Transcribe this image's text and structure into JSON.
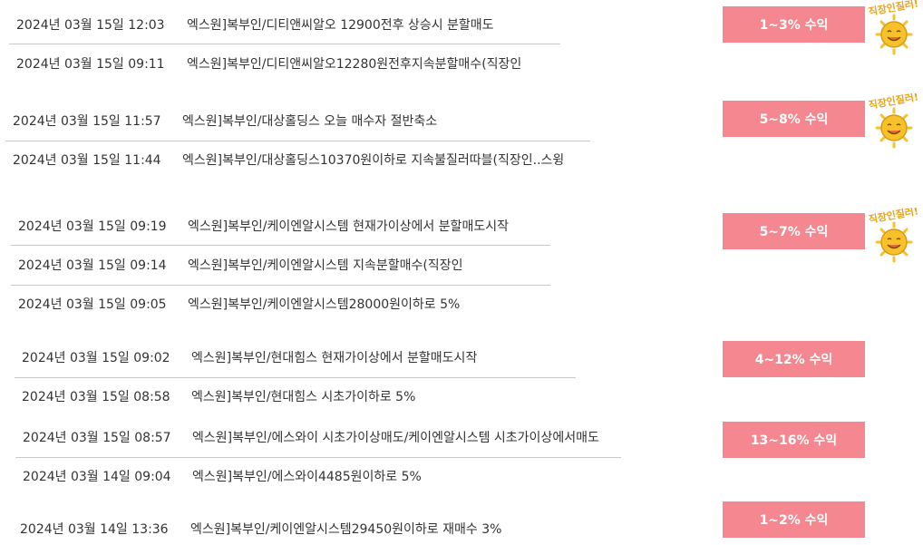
{
  "rows": [
    {
      "date": "2024년 03월 15일 12:03",
      "msg": "엑스원]복부인/디티앤씨알오 12900전후 상승시 분할매도"
    },
    {
      "date": "2024년 03월 15일 09:11",
      "msg": "엑스원]복부인/디티앤씨알오12280원전후지속분할매수(직장인"
    },
    {
      "date": "2024년 03월 15일 11:57",
      "msg": "엑스원]복부인/대상홀딩스 오늘 매수자 절반축소"
    },
    {
      "date": "2024년 03월 15일 11:44",
      "msg": "엑스원]복부인/대상홀딩스10370원이하로 지속불질러따블(직장인..스윙"
    },
    {
      "date": "2024년 03월 15일 09:19",
      "msg": "엑스원]복부인/케이엔알시스템 현재가이상에서 분할매도시작"
    },
    {
      "date": "2024년 03월 15일 09:14",
      "msg": "엑스원]복부인/케이엔알시스템 지속분할매수(직장인"
    },
    {
      "date": "2024년 03월 15일 09:05",
      "msg": "엑스원]복부인/케이엔알시스템28000원이하로 5%"
    },
    {
      "date": "2024년 03월 15일 09:02",
      "msg": "엑스원]복부인/현대힘스 현재가이상에서 분할매도시작"
    },
    {
      "date": "2024년 03월 15일 08:58",
      "msg": "엑스원]복부인/현대힘스 시초가이하로 5%"
    },
    {
      "date": "2024년 03월 15일 08:57",
      "msg": "엑스원]복부인/에스와이 시초가이상매도/케이엔알시스템 시초가이상에서매도"
    },
    {
      "date": "2024년 03월 14일 09:04",
      "msg": "엑스원]복부인/에스와이4485원이하로 5%"
    },
    {
      "date": "2024년 03월 14일 13:36",
      "msg": "엑스원]복부인/케이엔알시스템29450원이하로 재매수 3%"
    }
  ],
  "badges": [
    {
      "label": "1~3% 수익"
    },
    {
      "label": "5~8% 수익"
    },
    {
      "label": "5~7% 수익"
    },
    {
      "label": "4~12% 수익"
    },
    {
      "label": "13~16% 수익"
    },
    {
      "label": "1~2% 수익"
    }
  ],
  "mascot": {
    "text": "직장인질러!",
    "icon": "smiling-sun-mascot-icon"
  },
  "colors": {
    "badge": "#f4878f",
    "badge_text": "#ffffff",
    "text": "#333333",
    "separator": "#c8c8c8",
    "mascot_face": "#f6c12a",
    "mascot_text": "#e8a317"
  }
}
